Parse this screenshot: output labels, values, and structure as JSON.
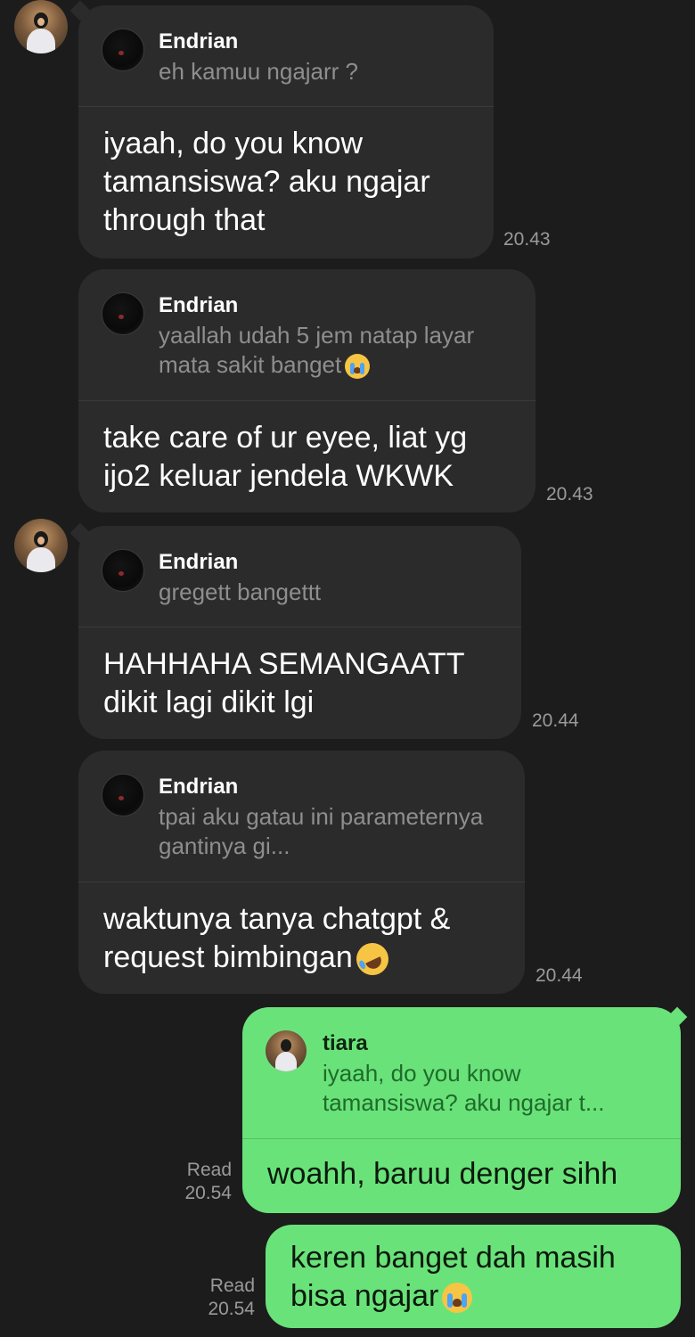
{
  "messages": [
    {
      "quote_name": "Endrian",
      "quote_text": "eh kamuu ngajarr ?",
      "text": "iyaah, do you know tamansiswa? aku ngajar through that",
      "time": "20.43"
    },
    {
      "quote_name": "Endrian",
      "quote_text": "yaallah udah 5 jem natap layar mata sakit banget",
      "quote_emoji": "loudly-crying-face-emoji",
      "text": "take care of ur eyee, liat yg ijo2 keluar jendela WKWK",
      "time": "20.43"
    },
    {
      "quote_name": "Endrian",
      "quote_text": "gregett bangettt",
      "text": "HAHHAHA SEMANGAATT dikit lagi dikit lgi",
      "time": "20.44"
    },
    {
      "quote_name": "Endrian",
      "quote_text": "tpai aku gatau ini parameternya gantinya gi...",
      "text": "waktunya tanya chatgpt & request bimbingan",
      "text_emoji": "rolling-on-floor-laughing-emoji",
      "time": "20.44"
    }
  ],
  "outgoing": [
    {
      "quote_name": "tiara",
      "quote_text": "iyaah, do you know tamansiswa? aku ngajar t...",
      "text": "woahh, baruu denger sihh",
      "status": "Read",
      "time": "20.54"
    },
    {
      "text": "keren banget dah masih bisa ngajar",
      "text_emoji": "loudly-crying-face-emoji",
      "status": "Read",
      "time": "20.54"
    }
  ],
  "colors": {
    "background": "#1c1c1c",
    "incoming_bubble": "#2b2b2b",
    "outgoing_bubble": "#6ae27a"
  }
}
